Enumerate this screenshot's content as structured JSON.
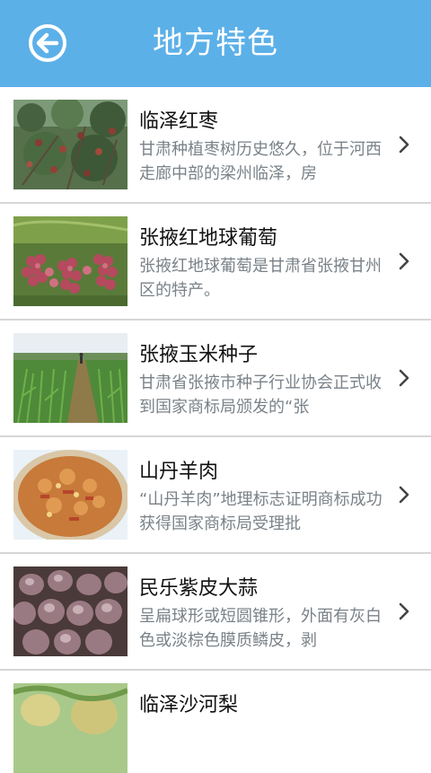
{
  "header": {
    "title": "地方特色",
    "back_icon": "back-arrow-icon",
    "color": "#5cb0e8"
  },
  "items": [
    {
      "name": "临泽红枣",
      "desc": "甘肃种植枣树历史悠久，位于河西走廊中部的梁州临泽，房",
      "image": "jujube-tree-photo"
    },
    {
      "name": "张掖红地球葡萄",
      "desc": "张掖红地球葡萄是甘肃省张掖甘州区的特产。",
      "image": "red-grapes-photo"
    },
    {
      "name": "张掖玉米种子",
      "desc": "甘肃省张掖市种子行业协会正式收到国家商标局颁发的“张",
      "image": "corn-field-photo"
    },
    {
      "name": "山丹羊肉",
      "desc": "“山丹羊肉”地理标志证明商标成功获得国家商标局受理批",
      "image": "mutton-dish-photo"
    },
    {
      "name": "民乐紫皮大蒜",
      "desc": "呈扁球形或短圆锥形，外面有灰白色或淡棕色膜质鳞皮，剥",
      "image": "purple-garlic-photo"
    },
    {
      "name": "临泽沙河梨",
      "desc": "",
      "image": "pear-photo"
    }
  ]
}
